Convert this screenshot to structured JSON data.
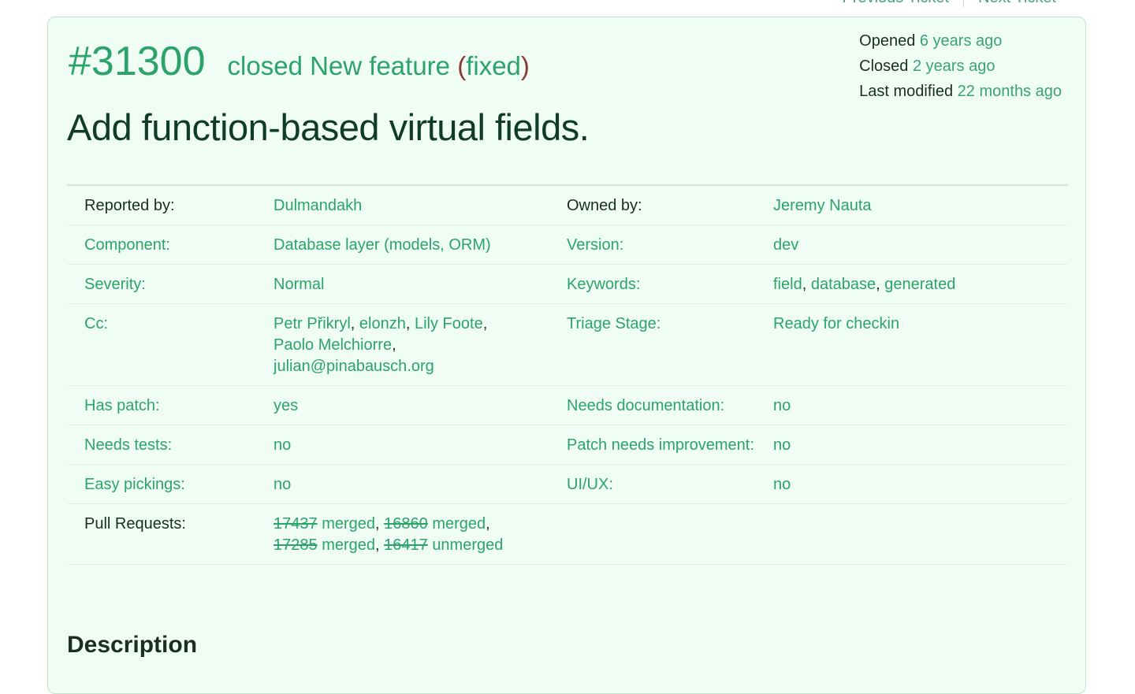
{
  "nav": {
    "previous": "Previous Ticket",
    "next": "Next Ticket"
  },
  "ticket": {
    "id": "#31300",
    "status": "closed",
    "type": "New feature",
    "resolution": "fixed",
    "summary": "Add function-based virtual fields.",
    "dates": {
      "opened_label": "Opened",
      "opened_value": "6 years ago",
      "closed_label": "Closed",
      "closed_value": "2 years ago",
      "modified_label": "Last modified",
      "modified_value": "22 months ago"
    }
  },
  "props": {
    "reported_by": {
      "label": "Reported by:",
      "value": "Dulmandakh"
    },
    "owned_by": {
      "label": "Owned by:",
      "value": "Jeremy Nauta"
    },
    "component": {
      "label": "Component:",
      "value": "Database layer (models, ORM)"
    },
    "version": {
      "label": "Version:",
      "value": "dev"
    },
    "severity": {
      "label": "Severity:",
      "value": "Normal"
    },
    "keywords": {
      "label": "Keywords:",
      "values": [
        "field",
        "database",
        "generated"
      ]
    },
    "cc": {
      "label": "Cc:",
      "values": [
        "Petr Přikryl",
        "elonzh",
        "Lily Foote",
        "Paolo Melchiorre",
        "julian@pinabausch.org"
      ]
    },
    "triage_stage": {
      "label": "Triage Stage:",
      "value": "Ready for checkin"
    },
    "has_patch": {
      "label": "Has patch:",
      "value": "yes"
    },
    "needs_documentation": {
      "label": "Needs documentation:",
      "value": "no"
    },
    "needs_tests": {
      "label": "Needs tests:",
      "value": "no"
    },
    "patch_needs_improvement": {
      "label": "Patch needs improvement:",
      "value": "no"
    },
    "easy_pickings": {
      "label": "Easy pickings:",
      "value": "no"
    },
    "ui_ux": {
      "label": "UI/UX:",
      "value": "no"
    },
    "pull_requests": {
      "label": "Pull Requests:",
      "items": [
        {
          "number": "17437",
          "state": "merged"
        },
        {
          "number": "16860",
          "state": "merged"
        },
        {
          "number": "17285",
          "state": "merged"
        },
        {
          "number": "16417",
          "state": "unmerged"
        }
      ]
    }
  },
  "description": {
    "heading": "Description"
  }
}
